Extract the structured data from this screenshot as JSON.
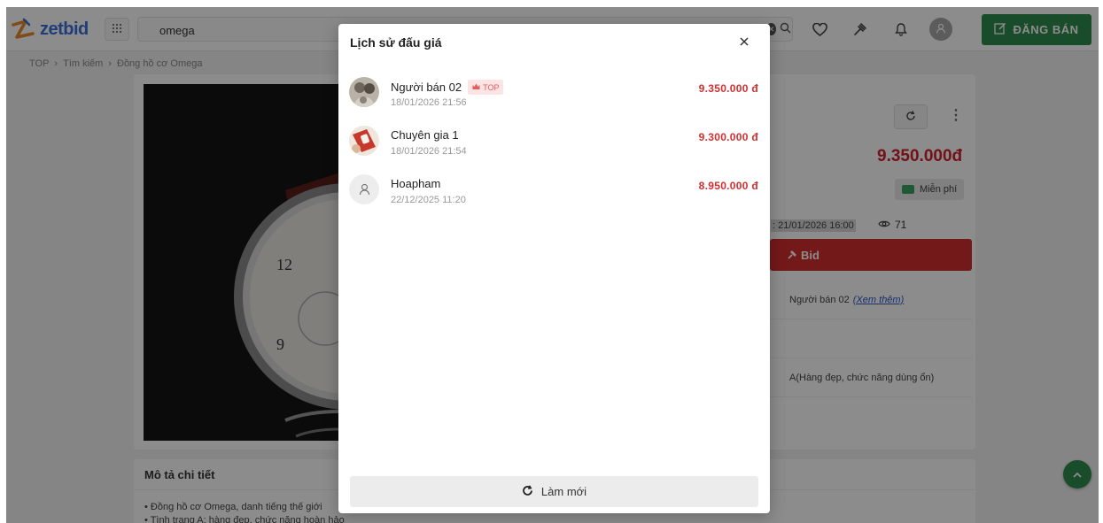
{
  "header": {
    "logo_text": "zetbid",
    "search_value": "omega",
    "sell_button": "ĐĂNG BÁN"
  },
  "breadcrumb": [
    "TOP",
    "Tìm kiếm",
    "Đồng hồ cơ Omega"
  ],
  "product": {
    "price": "9.350.000đ",
    "shipping": "Miễn phí",
    "end_time": "21/01/2026 16:00",
    "views": "71",
    "bid_button": "Bid",
    "seller_name": "Người bán 02",
    "seller_link": "(Xem thêm)",
    "condition": "A(Hàng đẹp, chức năng dùng ổn)"
  },
  "description": {
    "title": "Mô tả chi tiết",
    "lines": [
      "• Đồng hồ cơ Omega, danh tiếng thế giới",
      "• Tình trạng A: hàng đẹp, chức năng hoàn hảo"
    ]
  },
  "modal": {
    "title": "Lịch sử đấu giá",
    "refresh_label": "Làm mới",
    "bids": [
      {
        "name": "Người bán 02",
        "badge": "TOP",
        "time": "18/01/2026 21:56",
        "amount": "9.350.000 đ",
        "avatar": "avatar-photo-1"
      },
      {
        "name": "Chuyên gia 1",
        "badge": "",
        "time": "18/01/2026 21:54",
        "amount": "9.300.000 đ",
        "avatar": "avatar-photo-2"
      },
      {
        "name": "Hoapham",
        "badge": "",
        "time": "22/12/2025 11:20",
        "amount": "8.950.000 đ",
        "avatar": "user-icon"
      }
    ]
  },
  "colors": {
    "brand_green": "#2e8b4e",
    "price_red": "#d32f2f",
    "logo_blue": "#3a6fd9",
    "badge_bg": "#fde4e4"
  }
}
